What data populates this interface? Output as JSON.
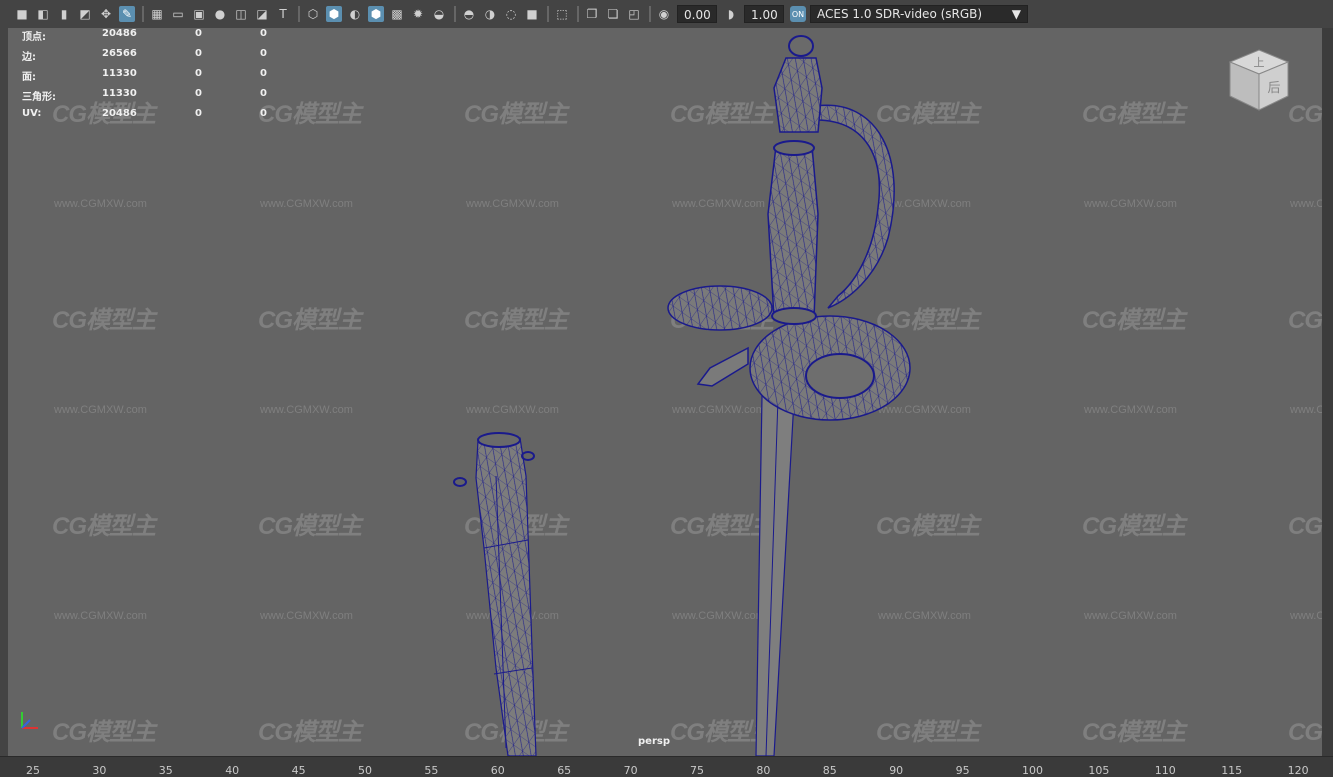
{
  "toolbar": {
    "icons": [
      "camera-icon",
      "camera-attributes-icon",
      "bookmark-icon",
      "image-plane-icon",
      "2d-pan-icon",
      "grease-pencil-icon",
      "grid-icon",
      "film-gate-icon",
      "resolution-gate-icon",
      "gate-mask-icon",
      "field-chart-icon",
      "safe-action-icon",
      "safe-title-icon",
      "wireframe-icon",
      "smooth-shade-icon",
      "flat-shade-icon",
      "wireframe-on-shaded-icon",
      "textured-icon",
      "lights-icon",
      "shadows-icon",
      "ambient-occlusion-icon",
      "motion-blur-icon",
      "anti-alias-icon",
      "depth-of-field-icon",
      "isolate-select-icon",
      "xray-icon",
      "xray-joints-icon",
      "backface-icon"
    ],
    "exposure_value": "0.00",
    "gamma_value": "1.00",
    "color_space": "ACES 1.0 SDR-video (sRGB)"
  },
  "hud": {
    "rows": [
      {
        "label": "顶点:",
        "v1": "20486",
        "v2": "0",
        "v3": "0"
      },
      {
        "label": "边:",
        "v1": "26566",
        "v2": "0",
        "v3": "0"
      },
      {
        "label": "面:",
        "v1": "11330",
        "v2": "0",
        "v3": "0"
      },
      {
        "label": "三角形:",
        "v1": "11330",
        "v2": "0",
        "v3": "0"
      },
      {
        "label": "UV:",
        "v1": "20486",
        "v2": "0",
        "v3": "0"
      }
    ]
  },
  "viewport": {
    "camera": "persp",
    "view_cube": {
      "top_face": "上",
      "side_face": "后"
    }
  },
  "watermark": {
    "logo_text": "CG模型主",
    "url_text": "www.CGMXW.com"
  },
  "timeline": {
    "ticks": [
      "25",
      "30",
      "35",
      "40",
      "45",
      "50",
      "55",
      "60",
      "65",
      "70",
      "75",
      "80",
      "85",
      "90",
      "95",
      "100",
      "105",
      "110",
      "115",
      "120"
    ]
  },
  "colors": {
    "viewport_bg": "#646464",
    "wire": "#1a1a8c",
    "mesh_fill": "#7a7a7a",
    "accent": "#5b8fb0"
  }
}
